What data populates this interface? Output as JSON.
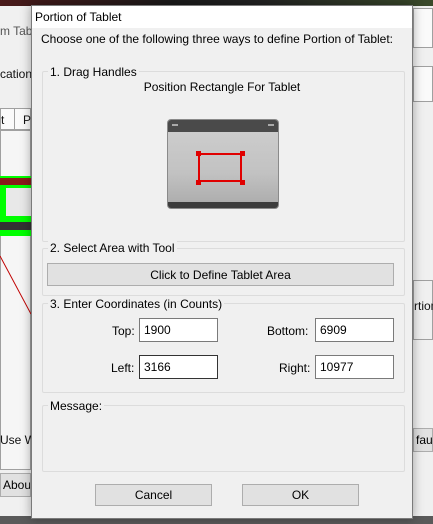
{
  "background": {
    "title_fragment": "m Tab",
    "menu_fragment": "cation",
    "tab_fragment_1": "t",
    "tab_fragment_2": "P",
    "right_fragment_1": "rtion",
    "use_fragment": "Use Wi",
    "default_fragment": "faul",
    "about_fragment": "About"
  },
  "dialog": {
    "title": "Portion of Tablet",
    "instruction": "Choose one of the following three ways to define Portion of Tablet:",
    "drag": {
      "group_title": "1. Drag Handles",
      "caption": "Position Rectangle For Tablet"
    },
    "tool": {
      "group_title": "2. Select Area with Tool",
      "button_label": "Click to Define Tablet Area"
    },
    "coords": {
      "group_title": "3. Enter Coordinates (in Counts)",
      "top_label": "Top:",
      "top_value": "1900",
      "bottom_label": "Bottom:",
      "bottom_value": "6909",
      "left_label": "Left:",
      "left_value": "3166",
      "right_label": "Right:",
      "right_value": "10977"
    },
    "message": {
      "group_title": "Message:"
    },
    "cancel_label": "Cancel",
    "ok_label": "OK"
  },
  "colors": {
    "selection": "#e00000",
    "background_green": "#00ff00"
  }
}
